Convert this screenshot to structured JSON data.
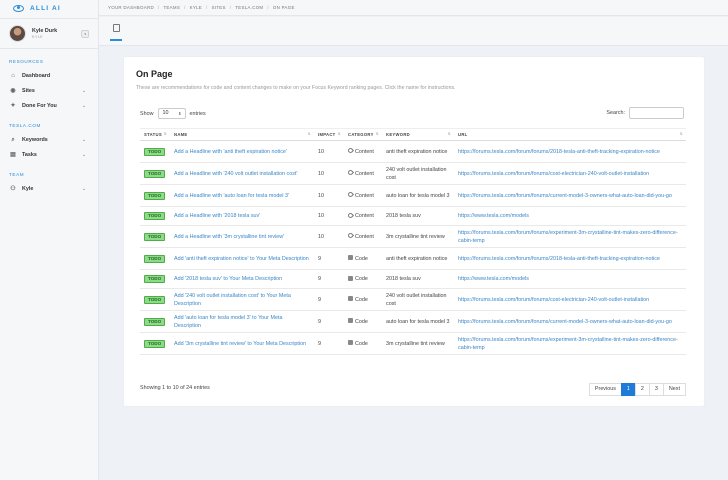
{
  "app": {
    "name": "ALLI AI"
  },
  "profile": {
    "name": "Kyle Durk",
    "role": "KYLE",
    "toggle": "◂"
  },
  "sidebar": {
    "sections": [
      {
        "title": "RESOURCES",
        "items": [
          {
            "label": "Dashboard",
            "icon": "home-icon",
            "glyph": "⌂",
            "has_chevron": false
          },
          {
            "label": "Sites",
            "icon": "pin-icon",
            "glyph": "◉",
            "has_chevron": true
          },
          {
            "label": "Done For You",
            "icon": "star-icon",
            "glyph": "✦",
            "has_chevron": true
          }
        ]
      },
      {
        "title": "TESLA.COM",
        "items": [
          {
            "label": "Keywords",
            "icon": "key-icon",
            "glyph": "⌕",
            "has_chevron": true
          },
          {
            "label": "Tasks",
            "icon": "task-icon",
            "glyph": "▤",
            "has_chevron": true
          }
        ]
      },
      {
        "title": "TEAM",
        "items": [
          {
            "label": "Kyle",
            "icon": "user-icon",
            "glyph": "⚇",
            "has_chevron": true
          }
        ]
      }
    ]
  },
  "breadcrumb": [
    "YOUR DASHBOARD",
    "TEAMS",
    "KYLE",
    "SITES",
    "TESLA.COM",
    "ON PAGE"
  ],
  "page": {
    "title": "On Page",
    "description": "These are recommendations for code and content changes to make on your Focus Keyword ranking pages. Click the name for instructions."
  },
  "controls": {
    "show_label": "Show",
    "entries_value": "10",
    "entries_label": "entries",
    "search_label": "Search:"
  },
  "table": {
    "columns": [
      "STATUS",
      "NAME",
      "IMPACT",
      "CATEGORY",
      "KEYWORD",
      "URL"
    ],
    "rows": [
      {
        "status": "TODO",
        "name": "Add a Headline with 'anti theft expiration notice'",
        "impact": "10",
        "category": "Content",
        "keyword": "anti theft expiration notice",
        "url": "https://forums.tesla.com/forum/forums/2018-tesla-anti-theft-tracking-expiration-notice"
      },
      {
        "status": "TODO",
        "name": "Add a Headline with '240 volt outlet installation cost'",
        "impact": "10",
        "category": "Content",
        "keyword": "240 volt outlet installation cost",
        "url": "https://forums.tesla.com/forum/forums/cost-electrician-240-volt-outlet-installation"
      },
      {
        "status": "TODO",
        "name": "Add a Headline with 'auto loan for tesla model 3'",
        "impact": "10",
        "category": "Content",
        "keyword": "auto loan for tesla model 3",
        "url": "https://forums.tesla.com/forum/forums/current-model-3-owners-what-auto-loan-did-you-go"
      },
      {
        "status": "TODO",
        "name": "Add a Headline with '2018 tesla suv'",
        "impact": "10",
        "category": "Content",
        "keyword": "2018 tesla suv",
        "url": "https://www.tesla.com/models"
      },
      {
        "status": "TODO",
        "name": "Add a Headline with '3m crystalline tint review'",
        "impact": "10",
        "category": "Content",
        "keyword": "3m crystalline tint review",
        "url": "https://forums.tesla.com/forum/forums/experiment-3m-crystalline-tint-makes-zero-difference-cabin-temp"
      },
      {
        "status": "TODO",
        "name": "Add 'anti theft expiration notice' to Your Meta Description",
        "impact": "9",
        "category": "Code",
        "keyword": "anti theft expiration notice",
        "url": "https://forums.tesla.com/forum/forums/2018-tesla-anti-theft-tracking-expiration-notice"
      },
      {
        "status": "TODO",
        "name": "Add '2018 tesla suv' to Your Meta Description",
        "impact": "9",
        "category": "Code",
        "keyword": "2018 tesla suv",
        "url": "https://www.tesla.com/models"
      },
      {
        "status": "TODO",
        "name": "Add '240 volt outlet installation cost' to Your Meta Description",
        "impact": "9",
        "category": "Code",
        "keyword": "240 volt outlet installation cost",
        "url": "https://forums.tesla.com/forum/forums/cost-electrician-240-volt-outlet-installation"
      },
      {
        "status": "TODO",
        "name": "Add 'auto loan for tesla model 3' to Your Meta Description",
        "impact": "9",
        "category": "Code",
        "keyword": "auto loan for tesla model 3",
        "url": "https://forums.tesla.com/forum/forums/current-model-3-owners-what-auto-loan-did-you-go"
      },
      {
        "status": "TODO",
        "name": "Add '3m crystalline tint review' to Your Meta Description",
        "impact": "9",
        "category": "Code",
        "keyword": "3m crystalline tint review",
        "url": "https://forums.tesla.com/forum/forums/experiment-3m-crystalline-tint-makes-zero-difference-cabin-temp"
      }
    ]
  },
  "footer": {
    "info": "Showing 1 to 10 of 24 entries",
    "pagination": [
      {
        "label": "Previous",
        "active": false
      },
      {
        "label": "1",
        "active": true
      },
      {
        "label": "2",
        "active": false
      },
      {
        "label": "3",
        "active": false
      },
      {
        "label": "Next",
        "active": false
      }
    ]
  },
  "colors": {
    "accent": "#2a8bd6",
    "todo_bg": "#8fd98a",
    "todo_border": "#4cae47",
    "page_active": "#1e7bd8"
  }
}
